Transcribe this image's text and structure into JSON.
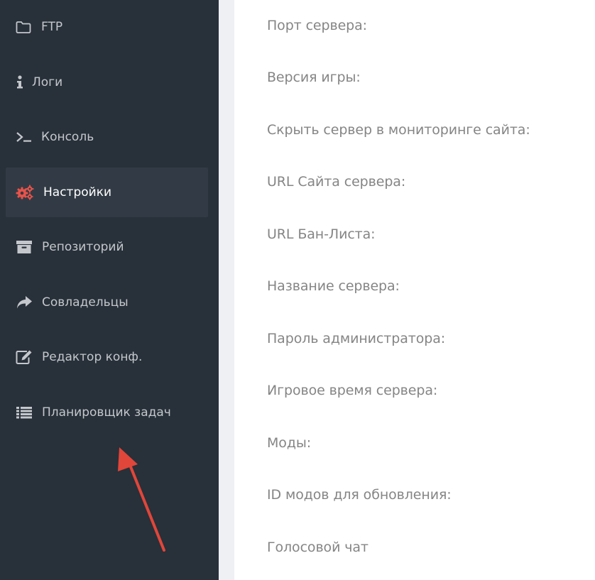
{
  "sidebar": {
    "items": [
      {
        "label": "FTP",
        "icon": "folder-icon"
      },
      {
        "label": "Логи",
        "icon": "info-icon"
      },
      {
        "label": "Консоль",
        "icon": "terminal-icon"
      },
      {
        "label": "Настройки",
        "icon": "gears-icon",
        "active": true
      },
      {
        "label": "Репозиторий",
        "icon": "archive-icon"
      },
      {
        "label": "Совладельцы",
        "icon": "share-icon"
      },
      {
        "label": "Редактор конф.",
        "icon": "edit-icon"
      },
      {
        "label": "Планировщик задач",
        "icon": "list-icon"
      }
    ]
  },
  "settings": {
    "fields": [
      "Порт сервера:",
      "Версия игры:",
      "Скрыть сервер в мониторинге сайта:",
      "URL Сайта сервера:",
      "URL Бан-Листа:",
      "Название сервера:",
      "Пароль администратора:",
      "Игровое время сервера:",
      "Моды:",
      "ID модов для обновления:",
      "Голосовой чат"
    ]
  },
  "colors": {
    "sidebar_bg": "#283039",
    "active_bg": "#323b45",
    "active_icon": "#e8534a",
    "label_text": "#858585",
    "arrow": "#e0463a"
  }
}
